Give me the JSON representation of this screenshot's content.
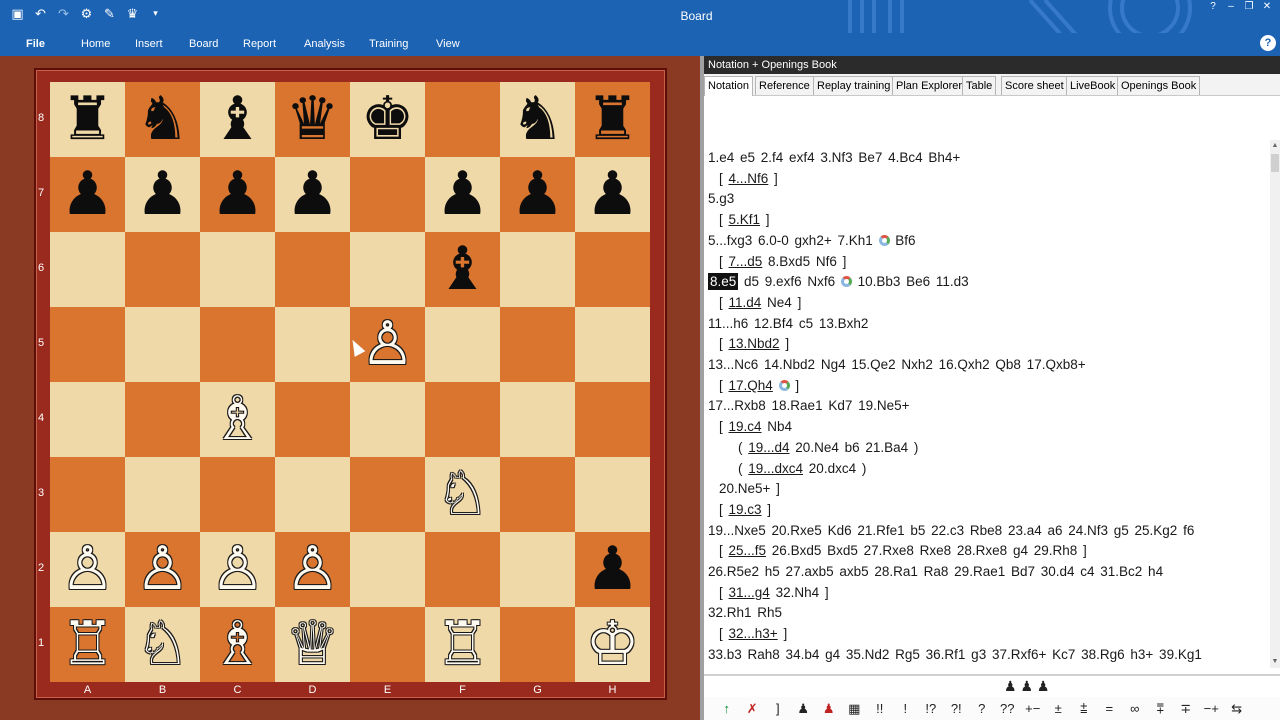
{
  "window": {
    "title": "Board"
  },
  "quick_access": [
    "new-file-icon",
    "undo-icon",
    "redo-icon",
    "settings-icon",
    "brush-icon",
    "engine-icon",
    "dropdown-icon"
  ],
  "ribbon": {
    "tabs": [
      "File",
      "Home",
      "Insert",
      "Board",
      "Report",
      "Analysis",
      "Training",
      "View"
    ]
  },
  "board": {
    "ranks": [
      "8",
      "7",
      "6",
      "5",
      "4",
      "3",
      "2",
      "1"
    ],
    "files": [
      "A",
      "B",
      "C",
      "D",
      "E",
      "F",
      "G",
      "H"
    ],
    "squares": [
      [
        "♜",
        "♞",
        "♝",
        "♛",
        "♚",
        "",
        "♞",
        "♜"
      ],
      [
        "♟",
        "♟",
        "♟",
        "♟",
        "",
        "♟",
        "♟",
        "♟"
      ],
      [
        "",
        "",
        "",
        "",
        "",
        "♝",
        "",
        ""
      ],
      [
        "",
        "",
        "",
        "",
        "♙",
        "",
        "",
        ""
      ],
      [
        "",
        "",
        "♗",
        "",
        "",
        "",
        "",
        ""
      ],
      [
        "",
        "",
        "",
        "",
        "",
        "♘",
        "",
        ""
      ],
      [
        "♙",
        "♙",
        "♙",
        "♙",
        "",
        "",
        "",
        "♟"
      ],
      [
        "♖",
        "♘",
        "♗",
        "♕",
        "",
        "♖",
        "",
        "♔"
      ]
    ],
    "colors": {
      "light": "#f0d9a8",
      "dark": "#d9752f",
      "frame": "#9a2a1e"
    }
  },
  "notation_pane": {
    "title": "Notation + Openings Book",
    "tabs": [
      "Notation",
      "Reference",
      "Replay training",
      "Plan Explorer",
      "Table",
      "Score sheet",
      "LiveBook",
      "Openings Book"
    ],
    "active_tab": "Notation",
    "lines": [
      {
        "t": "1.e4  e5  2.f4  exf4  3.Nf3  Be7  4.Bc4  Bh4+"
      },
      {
        "pre": "[ ",
        "u": "4...Nf6",
        "post": " ]"
      },
      {
        "t": "5.g3"
      },
      {
        "pre": "[ ",
        "u": "5.Kf1",
        "post": " ]"
      },
      {
        "t": "5...fxg3  6.0-0  gxh2+  7.Kh1  ",
        "ring": true,
        "post2": " Bf6"
      },
      {
        "pre": "[ ",
        "u": "7...d5",
        "post": "  8.Bxd5  Nf6 ]"
      },
      {
        "hl": "8.e5",
        "t": " d5  9.exf6  Nxf6  ",
        "ring": true,
        "post2": " 10.Bb3  Be6  11.d3"
      },
      {
        "pre": "[ ",
        "u": "11.d4",
        "post": "  Ne4 ]"
      },
      {
        "t": "11...h6  12.Bf4  c5  13.Bxh2"
      },
      {
        "pre": "[ ",
        "u": "13.Nbd2",
        "post": " ]"
      },
      {
        "t": "13...Nc6  14.Nbd2  Ng4  15.Qe2  Nxh2  16.Qxh2  Qb8  17.Qxb8+"
      },
      {
        "pre": "[ ",
        "u": "17.Qh4",
        "post": "  ",
        "ring": true,
        "post2": " ]"
      },
      {
        "t": "17...Rxb8  18.Rae1  Kd7  19.Ne5+"
      },
      {
        "pre": "[ ",
        "u": "19.c4",
        "post": "  Nb4"
      },
      {
        "pre": "( ",
        "u": "19...d4",
        "post": "  20.Ne4  b6  21.Ba4 )",
        "indent": 2
      },
      {
        "pre": "( ",
        "u": "19...dxc4",
        "post": "  20.dxc4 )",
        "indent": 2
      },
      {
        "t": "20.Ne5+ ]",
        "indent": 1
      },
      {
        "pre": "[ ",
        "u": "19.c3",
        "post": " ]"
      },
      {
        "t": "19...Nxe5  20.Rxe5  Kd6  21.Rfe1  b5  22.c3  Rbe8  23.a4  a6  24.Nf3  g5  25.Kg2  f6"
      },
      {
        "pre": "[ ",
        "u": "25...f5",
        "post": "  26.Bxd5  Bxd5  27.Rxe8  Rxe8  28.Rxe8  g4  29.Rh8 ]"
      },
      {
        "t": "26.R5e2  h5  27.axb5  axb5  28.Ra1  Ra8  29.Rae1  Bd7  30.d4  c4  31.Bc2  h4"
      },
      {
        "pre": "[ ",
        "u": "31...g4",
        "post": "  32.Nh4 ]"
      },
      {
        "t": "32.Rh1  Rh5"
      },
      {
        "pre": "[ ",
        "u": "32...h3+",
        "post": " ]"
      },
      {
        "t": "33.b3  Rah8  34.b4  g4  35.Nd2  Rg5  36.Rf1  g3  37.Rxf6+  Kc7  38.Rg6  h3+  39.Kg1"
      }
    ]
  },
  "pawn_strip": "♟ ♟ ♟",
  "annotation_symbols": [
    "↑",
    "✗",
    "]",
    "♟",
    "♟",
    "▦",
    "!!",
    "!",
    "!?",
    "?!",
    "?",
    "??",
    "+−",
    "±",
    "⩲",
    "=",
    "∞",
    "⩱",
    "∓",
    "−+",
    "⇆"
  ]
}
